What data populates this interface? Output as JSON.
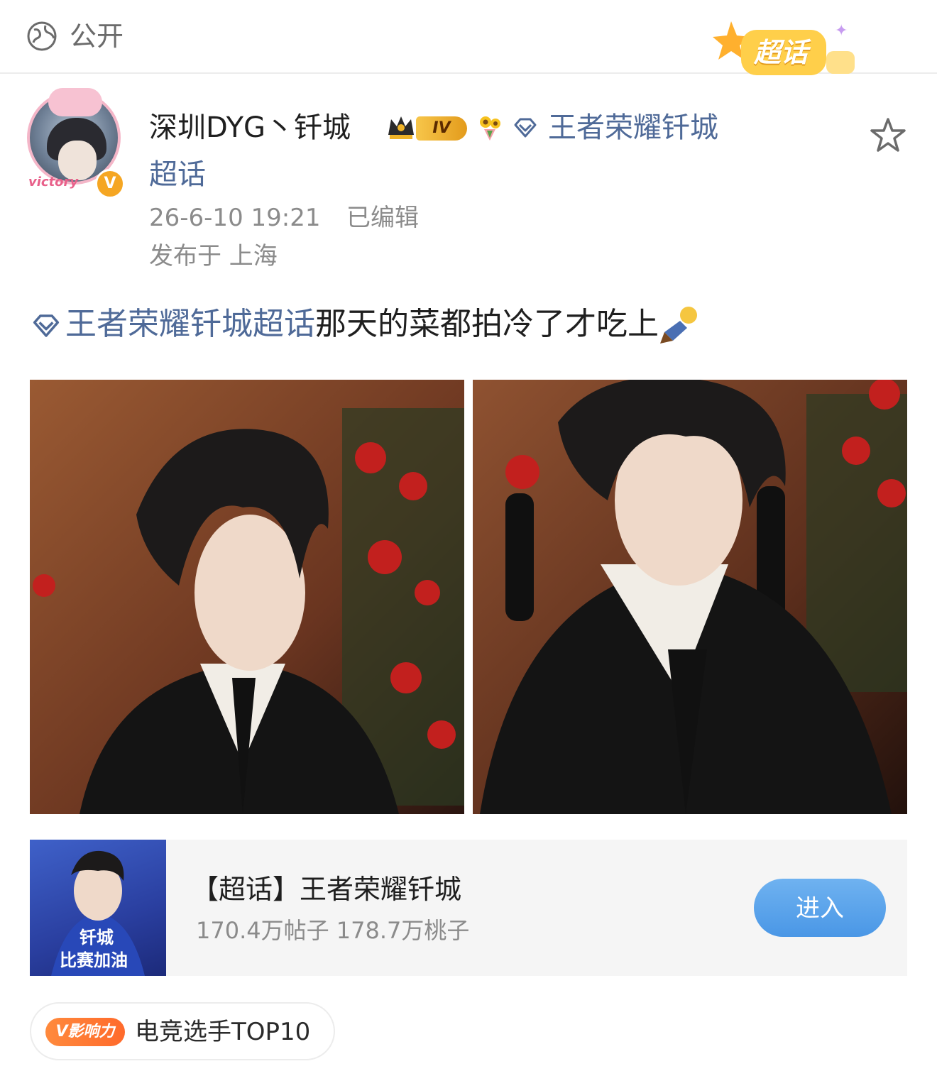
{
  "visibility": {
    "label": "公开",
    "icon": "globe-icon"
  },
  "supertopic_badge": {
    "label": "超话"
  },
  "author": {
    "name": "深圳DYG丶钎城",
    "avatar_text": "victory",
    "verified_mark": "V",
    "level_tag": "IV",
    "topic_link_line1": "王者荣耀钎城",
    "topic_link_line2": "超话",
    "timestamp": "26-6-10 19:21",
    "edited_label": "已编辑",
    "location": "发布于 上海"
  },
  "post": {
    "topic": "王者荣耀钎城超话",
    "text": "那天的菜都拍冷了才吃上"
  },
  "card": {
    "title": "【超话】王者荣耀钎城",
    "stats": "170.4万帖子  178.7万桃子",
    "thumb_caption_1": "钎城",
    "thumb_caption_2": "比赛加油",
    "button_label": "进入"
  },
  "influence": {
    "badge": "V影响力",
    "text": "电竞选手TOP10"
  },
  "colors": {
    "link": "#4f6a98",
    "button": "#4a97e6",
    "badge_orange": "#ff6a2b",
    "muted": "#8b8b8b"
  }
}
